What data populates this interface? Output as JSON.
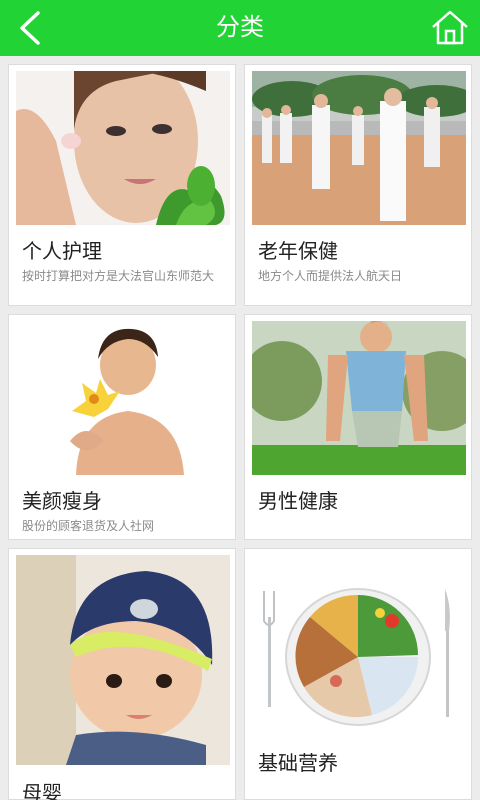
{
  "header": {
    "title": "分类",
    "back_icon": "chevron-left-icon",
    "home_icon": "home-icon",
    "background": "#22d336"
  },
  "categories": [
    {
      "name": "个人护理",
      "desc": "按时打算把对方是大法官山东师范大",
      "image": "woman-skincare-photo"
    },
    {
      "name": "老年保健",
      "desc": "地方个人而提供法人航天日",
      "image": "elderly-tai-chi-photo"
    },
    {
      "name": "美颜瘦身",
      "desc": "股份的顾客退货及人社网",
      "image": "woman-flower-photo"
    },
    {
      "name": "男性健康",
      "desc": "",
      "image": "man-pushup-photo"
    },
    {
      "name": "母婴",
      "desc": "",
      "image": "baby-hat-photo"
    },
    {
      "name": "基础营养",
      "desc": "",
      "image": "food-plate-photo"
    }
  ]
}
